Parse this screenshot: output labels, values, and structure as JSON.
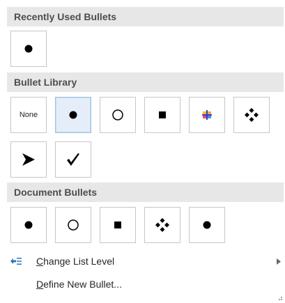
{
  "sections": {
    "recent": {
      "title": "Recently Used Bullets"
    },
    "library": {
      "title": "Bullet Library",
      "none_label": "None"
    },
    "document": {
      "title": "Document Bullets"
    }
  },
  "menu": {
    "change_level": {
      "accel": "C",
      "rest": "hange List Level"
    },
    "define_new": {
      "accel": "D",
      "rest": "efine New Bullet..."
    }
  },
  "icons": {
    "recent": [
      "filled-circle-bullet"
    ],
    "library": [
      "none",
      "filled-circle-bullet",
      "hollow-circle-bullet",
      "filled-square-bullet",
      "colored-cross-bullet",
      "diamond-cluster-bullet",
      "arrowhead-bullet",
      "checkmark-bullet"
    ],
    "document": [
      "filled-circle-bullet",
      "hollow-circle-bullet",
      "filled-square-bullet",
      "diamond-cluster-bullet",
      "filled-circle-bullet"
    ]
  },
  "colors": {
    "header_bg": "#e7e7e7",
    "selected_border": "#9cc2e4",
    "selected_bg": "#e5eef8",
    "change_level_icon": "#2e75b6"
  }
}
